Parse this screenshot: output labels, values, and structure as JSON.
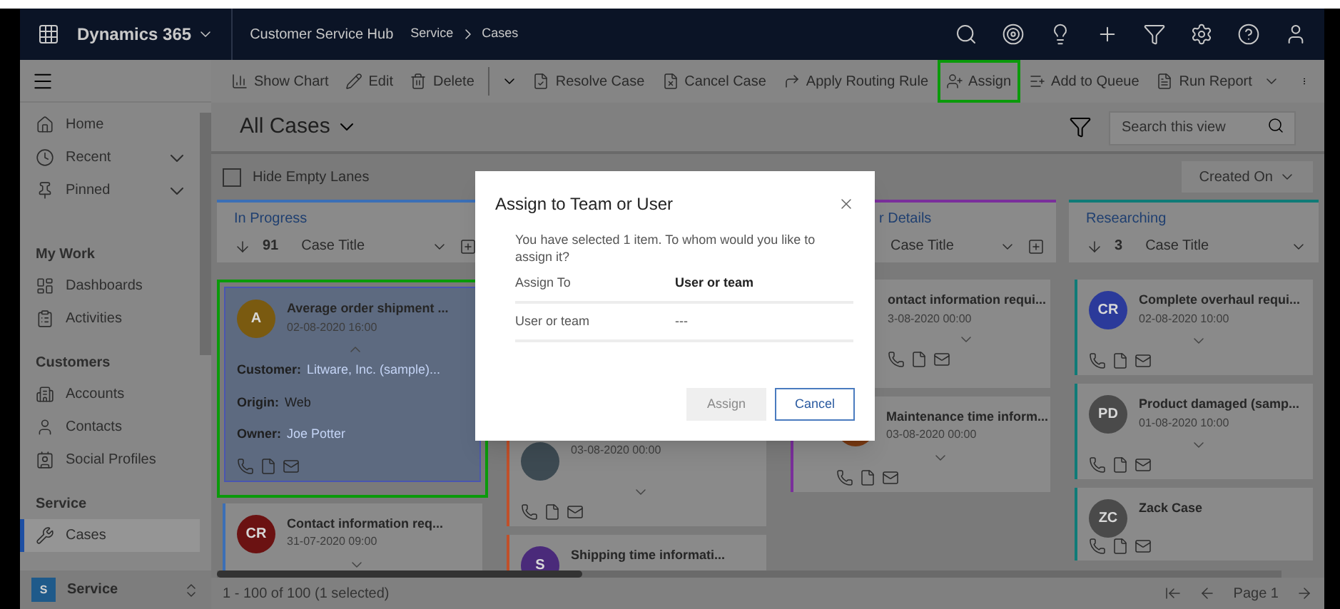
{
  "app_bar": {
    "app_name": "Dynamics 365",
    "hub": "Customer Service Hub",
    "breadcrumb": [
      "Service",
      "Cases"
    ]
  },
  "command_bar": [
    {
      "kind": "chart",
      "label": "Show Chart",
      "highlighted": false
    },
    {
      "kind": "edit",
      "label": "Edit",
      "highlighted": false
    },
    {
      "kind": "delete",
      "label": "Delete",
      "highlighted": false
    },
    {
      "kind": "split"
    },
    {
      "kind": "resolve",
      "label": "Resolve Case",
      "highlighted": false
    },
    {
      "kind": "cancel",
      "label": "Cancel Case",
      "highlighted": false
    },
    {
      "kind": "routing",
      "label": "Apply Routing Rule",
      "highlighted": false
    },
    {
      "kind": "assign",
      "label": "Assign",
      "highlighted": true
    },
    {
      "kind": "queue",
      "label": "Add to Queue",
      "highlighted": false
    },
    {
      "kind": "report",
      "label": "Run Report",
      "highlighted": false
    },
    {
      "kind": "more"
    }
  ],
  "sidebar": {
    "top": [
      {
        "kind": "home",
        "label": "Home",
        "expandable": false
      },
      {
        "kind": "recent",
        "label": "Recent",
        "expandable": true
      },
      {
        "kind": "pinned",
        "label": "Pinned",
        "expandable": true
      }
    ],
    "sections": [
      {
        "title": "My Work",
        "items": [
          {
            "kind": "dashboards",
            "label": "Dashboards",
            "selected": false
          },
          {
            "kind": "activities",
            "label": "Activities",
            "selected": false
          }
        ]
      },
      {
        "title": "Customers",
        "items": [
          {
            "kind": "accounts",
            "label": "Accounts",
            "selected": false
          },
          {
            "kind": "contacts",
            "label": "Contacts",
            "selected": false
          },
          {
            "kind": "social",
            "label": "Social Profiles",
            "selected": false
          }
        ]
      },
      {
        "title": "Service",
        "items": [
          {
            "kind": "cases",
            "label": "Cases",
            "selected": true
          }
        ]
      }
    ],
    "area": {
      "badge": "S",
      "label": "Service"
    }
  },
  "view": {
    "title": "All Cases",
    "search": {
      "placeholder": "Search this view"
    },
    "hide_empty_lanes": {
      "label": "Hide Empty Lanes",
      "checked": false
    },
    "sort": "Created On"
  },
  "lanes": [
    {
      "title": "In Progress",
      "count": "91",
      "sort_field": "Case Title",
      "color": "#3b6fb6",
      "cards": [
        {
          "initials": "A",
          "color": "#7a5a10",
          "title": "Average order shipment ...",
          "date": "02-08-2020 16:00",
          "selected": true,
          "expanded": true,
          "highlighted": true,
          "fields": [
            {
              "label": "Customer:",
              "value": "Litware, Inc. (sample)...",
              "link": true
            },
            {
              "label": "Origin:",
              "value": "Web",
              "link": false
            },
            {
              "label": "Owner:",
              "value": "Joe Potter",
              "link": true
            }
          ]
        },
        {
          "initials": "CR",
          "color": "#6b1212",
          "title": "Contact information req...",
          "date": "31-07-2020 09:00",
          "selected": false,
          "expanded": false,
          "highlighted": false
        }
      ]
    },
    {
      "color": "#c0502a",
      "cards": [
        {
          "color": "#3d4a52",
          "date": "03-08-2020 00:00",
          "selected": false,
          "expanded": false,
          "highlighted": false
        },
        {
          "initials": "S",
          "color": "#4a2a7a",
          "title": "Shipping time informati...",
          "selected": false,
          "highlighted": false
        }
      ]
    },
    {
      "title": "r Details",
      "sort_field": "Case Title",
      "color": "#7a2f9b",
      "cards": [
        {
          "title": "ontact information requi...",
          "date": "3-08-2020 00:00",
          "selected": false,
          "expanded": false,
          "highlighted": false
        },
        {
          "color": "#7a3a12",
          "title": "Maintenance time inform...",
          "date": "03-08-2020 00:00",
          "selected": false,
          "expanded": false,
          "highlighted": false
        }
      ]
    },
    {
      "title": "Researching",
      "count": "3",
      "sort_field": "Case Title",
      "color": "#0f7b77",
      "cards": [
        {
          "initials": "CR",
          "color": "#2b3a9a",
          "title": "Complete overhaul requi...",
          "date": "02-08-2020 10:00",
          "selected": false,
          "expanded": false,
          "highlighted": false
        },
        {
          "initials": "PD",
          "color": "#4a4a4a",
          "title": "Product damaged (samp...",
          "date": "01-08-2020 10:00",
          "selected": false,
          "expanded": false,
          "highlighted": false
        },
        {
          "initials": "ZC",
          "color": "#4a4a4a",
          "title": "Zack Case",
          "selected": false,
          "highlighted": false
        }
      ]
    }
  ],
  "dialog": {
    "title": "Assign to Team or User",
    "message": "You have selected 1 item. To whom would you like to assign it?",
    "fields": [
      {
        "label": "Assign To",
        "value": "User or team"
      },
      {
        "label": "User or team",
        "value": "---"
      }
    ],
    "buttons": [
      {
        "kind": "primary",
        "label": "Assign",
        "disabled": true
      },
      {
        "kind": "secondary",
        "label": "Cancel",
        "disabled": false
      }
    ]
  },
  "footer": {
    "record_count": "1 - 100 of 100 (1 selected)",
    "page": "Page 1"
  }
}
